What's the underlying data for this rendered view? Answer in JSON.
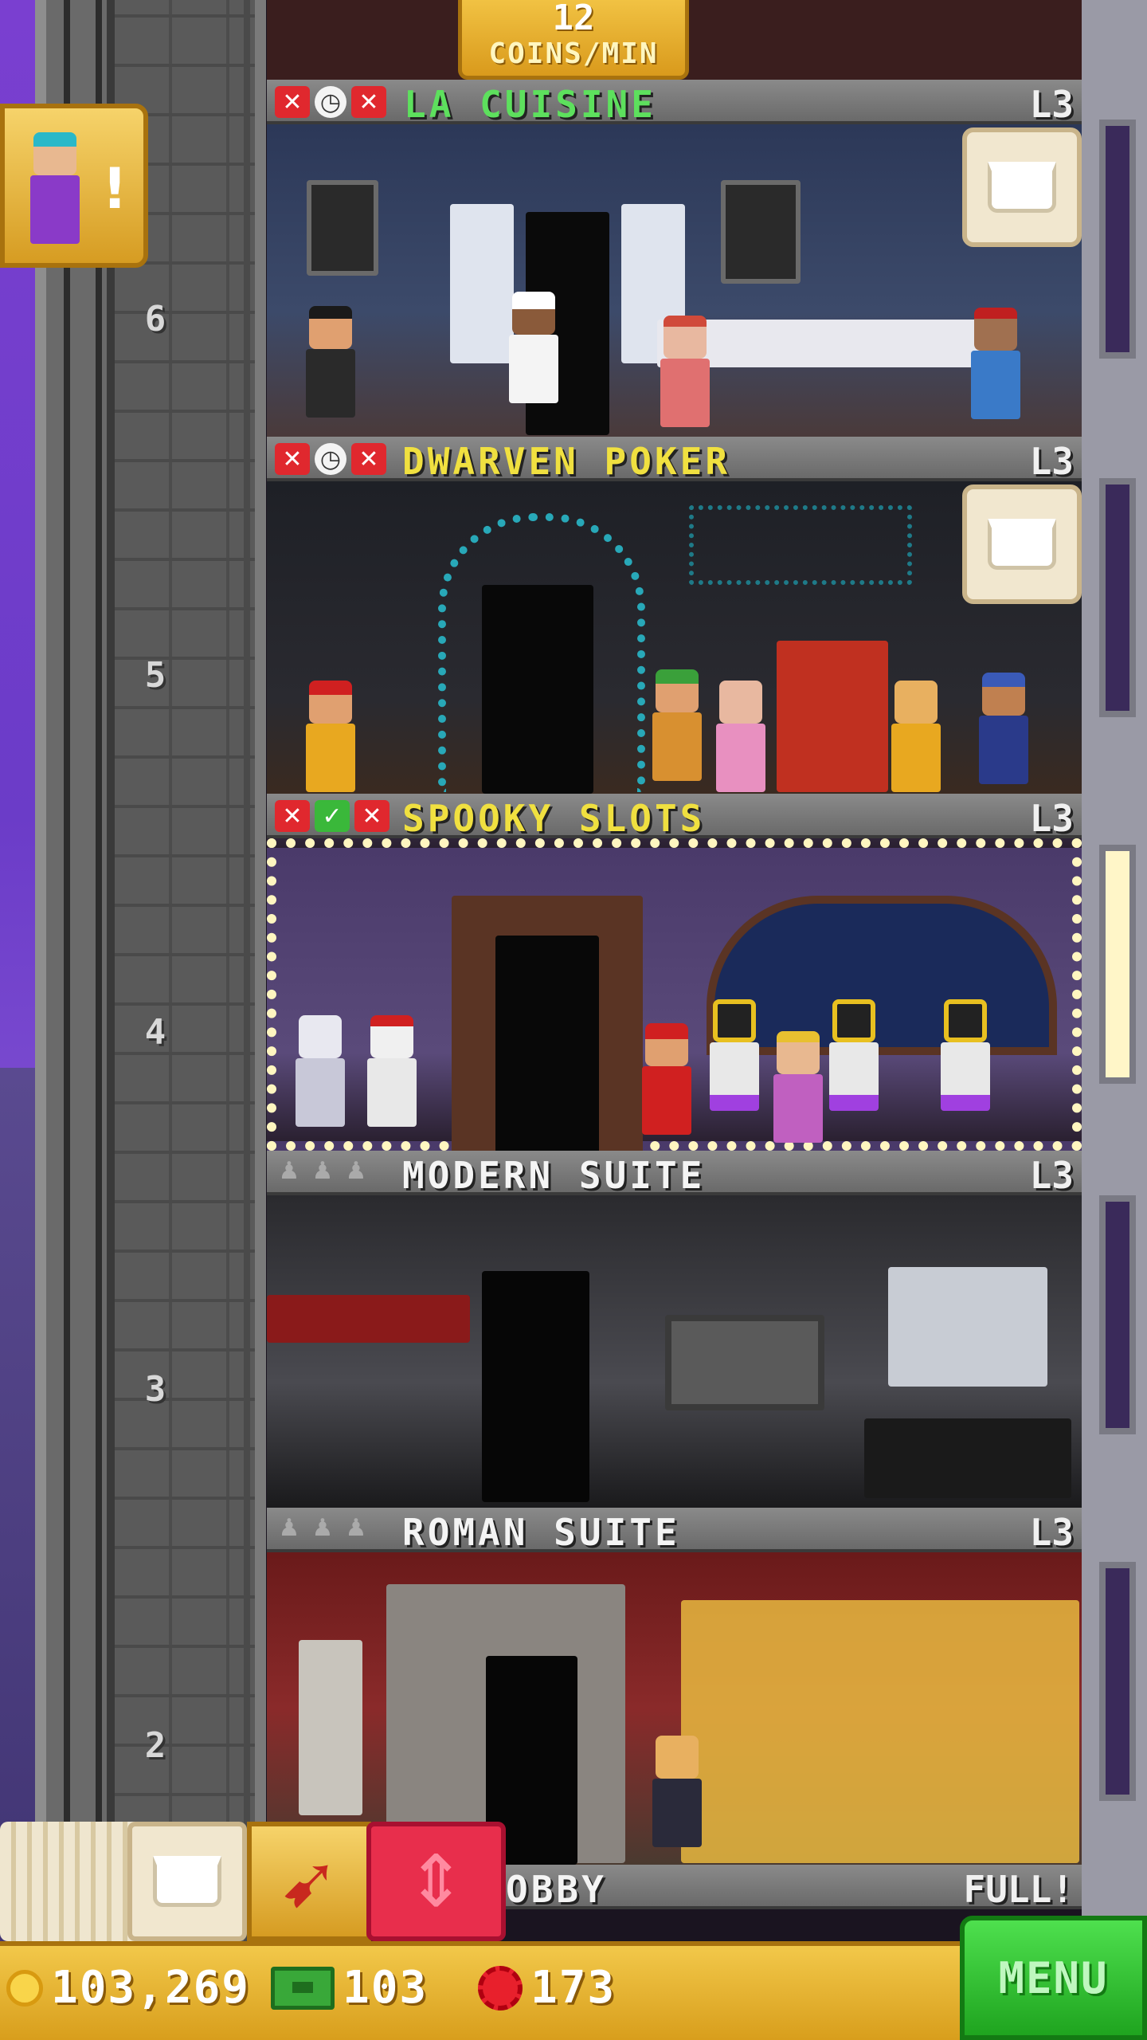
{
  "top_tag": {
    "value": "12",
    "unit": "COINS/MIN"
  },
  "floors": [
    {
      "number": "6",
      "name": "LA CUISINE",
      "level": "L3",
      "name_color": "#5de05d",
      "icons": [
        "x",
        "clock",
        "x"
      ],
      "restock": true
    },
    {
      "number": "5",
      "name": "DWARVEN POKER",
      "level": "L3",
      "name_color": "#f0e040",
      "icons": [
        "x",
        "clock",
        "x"
      ],
      "restock": true
    },
    {
      "number": "4",
      "name": "SPOOKY SLOTS",
      "level": "L3",
      "name_color": "#f0e040",
      "icons": [
        "x",
        "check",
        "x"
      ],
      "restock": false
    },
    {
      "number": "3",
      "name": "MODERN SUITE",
      "level": "L3",
      "name_color": "#f4f4f4",
      "icons": [
        "person",
        "person",
        "person"
      ],
      "restock": false
    },
    {
      "number": "2",
      "name": "ROMAN SUITE",
      "level": "L3",
      "name_color": "#f4f4f4",
      "icons": [
        "person",
        "person",
        "person"
      ],
      "restock": false
    }
  ],
  "lobby": {
    "name": "OBBY",
    "status": "FULL!"
  },
  "status": {
    "coins": "103,269",
    "bux": "103",
    "tickets": "173"
  },
  "menu_label": "MENU",
  "colors": {
    "gold": "#f2c84a",
    "menu_green": "#3cc83c",
    "elevator_red": "#e82e4c"
  }
}
